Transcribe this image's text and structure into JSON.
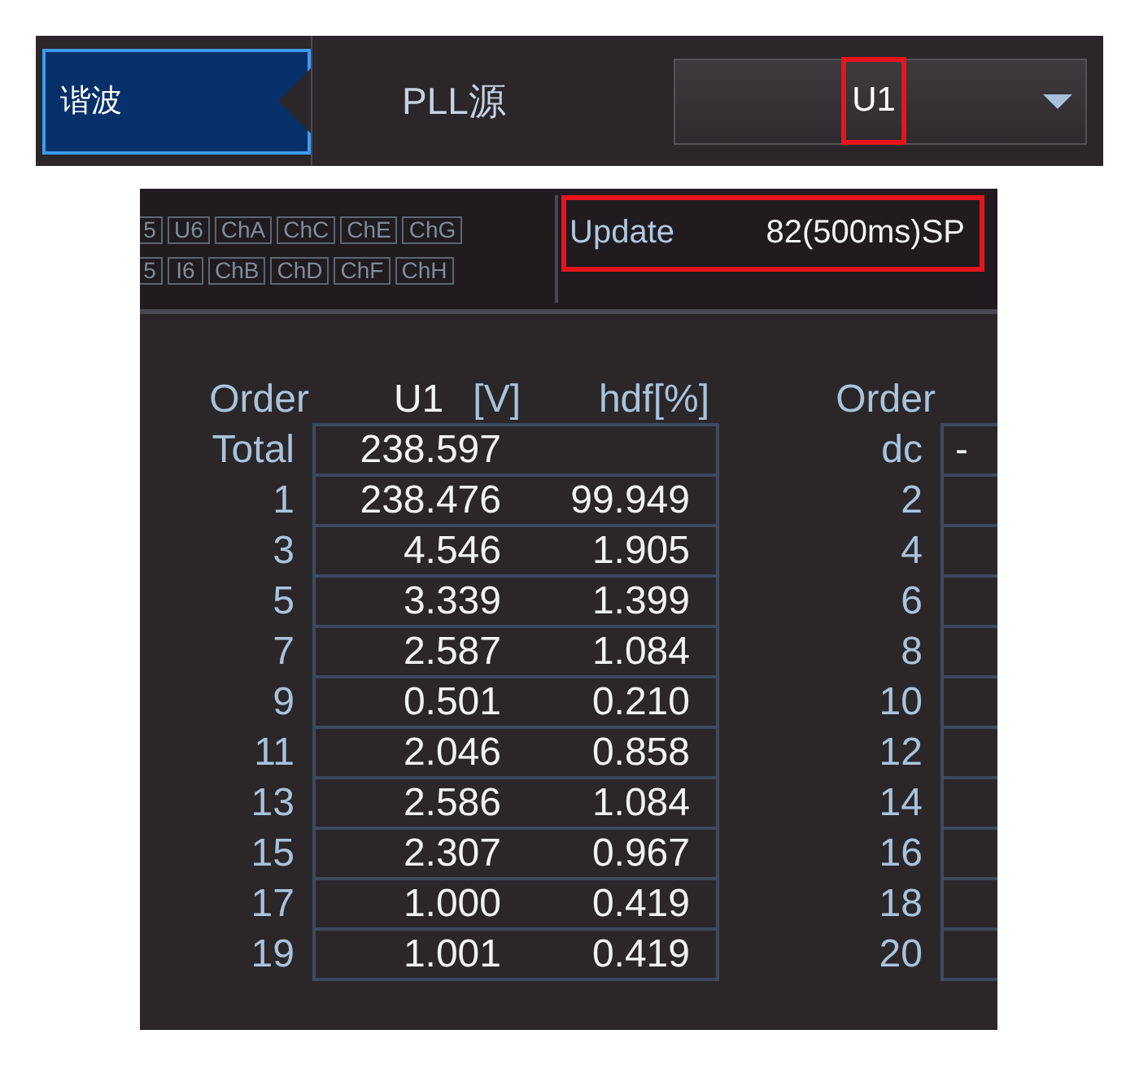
{
  "top_bar": {
    "tab": {
      "label": "谐波",
      "selected": true
    },
    "pll_source": {
      "label": "PLL源",
      "value": "U1",
      "highlighted": true
    }
  },
  "panel": {
    "channel_indicators": [
      [
        "5",
        "U6",
        "ChA",
        "ChC",
        "ChE",
        "ChG"
      ],
      [
        "5",
        "I6",
        "ChB",
        "ChD",
        "ChF",
        "ChH"
      ]
    ],
    "update": {
      "label": "Update",
      "value": "82(500ms)SP",
      "highlighted": true
    },
    "table": {
      "columns": [
        {
          "label": "Order"
        },
        {
          "name": "U1",
          "unit": "[V]"
        },
        {
          "label": "hdf[%]"
        }
      ],
      "rows": [
        {
          "order": "Total",
          "values": [
            "238.597"
          ]
        },
        {
          "order": "1",
          "values": [
            "238.476",
            "99.949"
          ]
        },
        {
          "order": "3",
          "values": [
            "4.546",
            "1.905"
          ]
        },
        {
          "order": "5",
          "values": [
            "3.339",
            "1.399"
          ]
        },
        {
          "order": "7",
          "values": [
            "2.587",
            "1.084"
          ]
        },
        {
          "order": "9",
          "values": [
            "0.501",
            "0.210"
          ]
        },
        {
          "order": "11",
          "values": [
            "2.046",
            "0.858"
          ]
        },
        {
          "order": "13",
          "values": [
            "2.586",
            "1.084"
          ]
        },
        {
          "order": "15",
          "values": [
            "2.307",
            "0.967"
          ]
        },
        {
          "order": "17",
          "values": [
            "1.000",
            "0.419"
          ]
        },
        {
          "order": "19",
          "values": [
            "1.001",
            "0.419"
          ]
        }
      ]
    },
    "table_2": {
      "columns": [
        {
          "label": "Order"
        }
      ],
      "rows": [
        {
          "order": "dc",
          "values": [
            "-"
          ]
        },
        {
          "order": "2"
        },
        {
          "order": "4"
        },
        {
          "order": "6"
        },
        {
          "order": "8"
        },
        {
          "order": "10"
        },
        {
          "order": "12"
        },
        {
          "order": "14"
        },
        {
          "order": "16"
        },
        {
          "order": "18"
        },
        {
          "order": "20"
        }
      ]
    }
  }
}
